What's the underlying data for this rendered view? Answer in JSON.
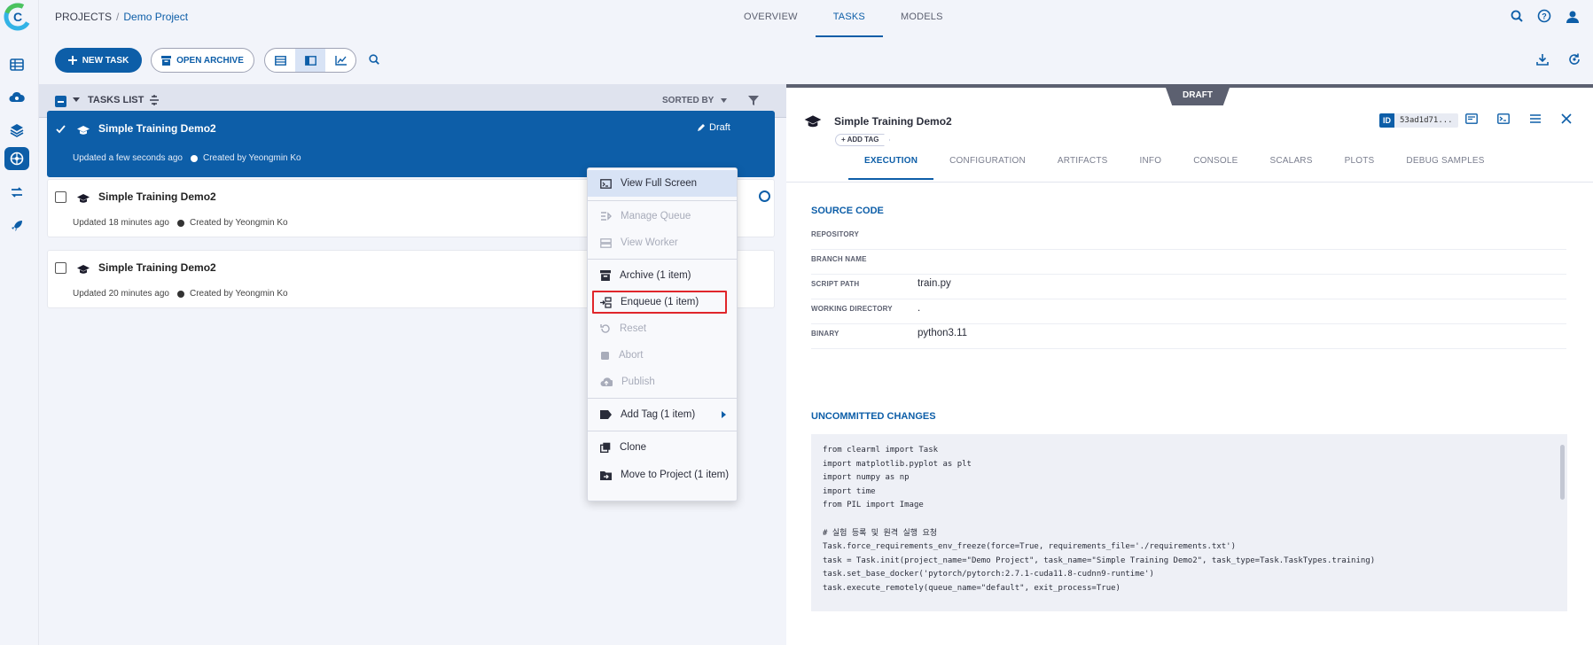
{
  "header": {
    "breadcrumb_root": "PROJECTS",
    "breadcrumb_separator": "/",
    "breadcrumb_project": "Demo Project",
    "tabs": [
      {
        "label": "OVERVIEW"
      },
      {
        "label": "TASKS"
      },
      {
        "label": "MODELS"
      }
    ],
    "active_tab": "TASKS",
    "right_icons": [
      "search-icon",
      "help-icon",
      "user-avatar-icon"
    ]
  },
  "sidebar": {
    "icons": [
      "dashboard-icon",
      "pipelines-cloud-icon",
      "datasets-layers-icon",
      "projects-brain-icon",
      "workers-queues-icon",
      "deploy-rocket-icon"
    ],
    "active_index": 3
  },
  "toolbar": {
    "new_task_label": "NEW TASK",
    "open_archive_label": "OPEN ARCHIVE",
    "view_modes": [
      "table-view-icon",
      "details-view-icon",
      "compare-chart-icon"
    ],
    "active_view": 1
  },
  "list": {
    "header_title": "TASKS LIST",
    "sort_label": "SORTED BY",
    "tasks": [
      {
        "name": "Simple Training Demo2",
        "updated": "Updated a few seconds ago",
        "created_by": "Created by Yeongmin Ko",
        "status": "Draft",
        "selected": true
      },
      {
        "name": "Simple Training Demo2",
        "updated": "Updated 18 minutes ago",
        "created_by": "Created by Yeongmin Ko",
        "status": "",
        "selected": false
      },
      {
        "name": "Simple Training Demo2",
        "updated": "Updated 20 minutes ago",
        "created_by": "Created by Yeongmin Ko",
        "status": "",
        "selected": false
      }
    ]
  },
  "context_menu": {
    "items": [
      {
        "label": "View Full Screen",
        "icon": "fullscreen-icon",
        "disabled": false
      },
      {
        "label": "Manage Queue",
        "icon": "queue-icon",
        "disabled": true
      },
      {
        "label": "View Worker",
        "icon": "worker-icon",
        "disabled": true
      },
      {
        "label": "Archive (1 item)",
        "icon": "archive-icon",
        "disabled": false
      },
      {
        "label": "Enqueue (1 item)",
        "icon": "enqueue-icon",
        "disabled": false
      },
      {
        "label": "Reset",
        "icon": "reset-icon",
        "disabled": true
      },
      {
        "label": "Abort",
        "icon": "abort-icon",
        "disabled": true
      },
      {
        "label": "Publish",
        "icon": "publish-icon",
        "disabled": true
      },
      {
        "label": "Add Tag (1 item)",
        "icon": "tag-icon",
        "disabled": false
      },
      {
        "label": "Clone",
        "icon": "clone-icon",
        "disabled": false
      },
      {
        "label": "Move to Project (1 item)",
        "icon": "move-icon",
        "disabled": false
      }
    ],
    "highlighted": "Enqueue (1 item)",
    "highlight_color": "#e0262b"
  },
  "details": {
    "status_badge": "DRAFT",
    "title": "Simple Training Demo2",
    "add_tag_label": "ADD TAG",
    "id_label": "ID",
    "id_value": "53ad1d71...",
    "tabs": [
      "EXECUTION",
      "CONFIGURATION",
      "ARTIFACTS",
      "INFO",
      "CONSOLE",
      "SCALARS",
      "PLOTS",
      "DEBUG SAMPLES"
    ],
    "active_tab": "EXECUTION",
    "source_code": {
      "title": "SOURCE CODE",
      "rows": [
        {
          "key": "REPOSITORY",
          "value": ""
        },
        {
          "key": "BRANCH NAME",
          "value": ""
        },
        {
          "key": "SCRIPT PATH",
          "value": "train.py"
        },
        {
          "key": "WORKING DIRECTORY",
          "value": "."
        },
        {
          "key": "BINARY",
          "value": "python3.11"
        }
      ]
    },
    "uncommitted": {
      "title": "UNCOMMITTED CHANGES",
      "code": "from clearml import Task\nimport matplotlib.pyplot as plt\nimport numpy as np\nimport time\nfrom PIL import Image\n\n# 실험 등록 및 원격 실행 요청\nTask.force_requirements_env_freeze(force=True, requirements_file='./requirements.txt')\ntask = Task.init(project_name=\"Demo Project\", task_name=\"Simple Training Demo2\", task_type=Task.TaskTypes.training)\ntask.set_base_docker('pytorch/pytorch:2.7.1-cuda11.8-cudnn9-runtime')\ntask.execute_remotely(queue_name=\"default\", exit_process=True)"
    }
  },
  "colors": {
    "accent": "#0d5ea8",
    "background": "#f2f4fa",
    "draft_badge": "#5c6070"
  }
}
